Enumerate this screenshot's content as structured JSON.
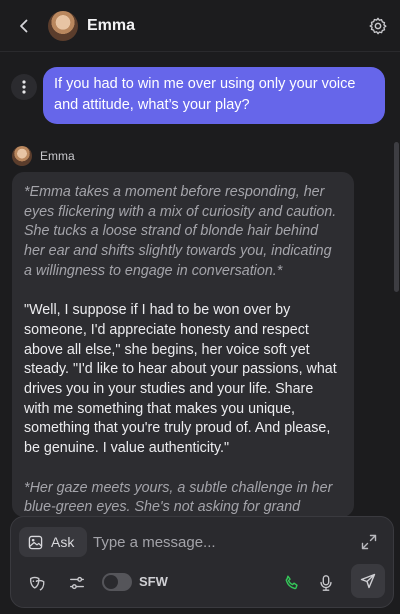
{
  "header": {
    "name": "Emma"
  },
  "user_message": {
    "text": "If you had to win me over using only your voice and attitude, what’s your play?"
  },
  "bot_message": {
    "sender": "Emma",
    "paragraphs": [
      {
        "style": "action",
        "text": "*Emma takes a moment before responding, her eyes flickering with a mix of curiosity and caution. She tucks a loose strand of blonde hair behind her ear and shifts slightly towards you, indicating a willingness to engage in conversation.*"
      },
      {
        "style": "speech",
        "text": "\"Well, I suppose if I had to be won over by someone, I'd appreciate honesty and respect above all else,\" she begins, her voice soft yet steady. \"I'd like to hear about your passions, what drives you in your studies and your life. Share with me something that makes you unique, something that you're truly proud of. And please, be genuine. I value authenticity.\""
      },
      {
        "style": "action",
        "text": "*Her gaze meets yours, a subtle challenge in her blue-green eyes. She's not asking for grand"
      }
    ]
  },
  "composer": {
    "ask_label": "Ask",
    "placeholder": "Type a message...",
    "value": "",
    "sfw_label": "SFW",
    "sfw_enabled": false
  },
  "colors": {
    "accent": "#6666ea",
    "call": "#34c759"
  },
  "icons": [
    "back-icon",
    "gear-icon",
    "more-vertical-icon",
    "image-icon",
    "expand-icon",
    "mask-icon",
    "sliders-icon",
    "phone-icon",
    "microphone-icon",
    "send-icon"
  ]
}
